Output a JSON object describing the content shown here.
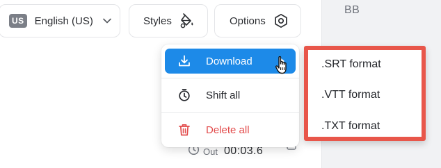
{
  "toolbar": {
    "language_code": "US",
    "language_label": "English (US)",
    "styles_label": "Styles",
    "options_label": "Options"
  },
  "right_panel": {
    "text": "BB"
  },
  "menu": {
    "items": [
      {
        "label": "Download",
        "icon": "download-icon",
        "state": "hover"
      },
      {
        "label": "Shift all",
        "icon": "timer-icon"
      },
      {
        "label": "Delete all",
        "icon": "trash-icon",
        "color": "#e24b4b"
      }
    ],
    "highlight_color": "#1d8ae8"
  },
  "submenu": {
    "items": [
      ".SRT format",
      ".VTT format",
      ".TXT format"
    ],
    "outline_color": "#e8564a"
  },
  "timing": {
    "out_label": "Out",
    "out_time": "00:03.6"
  }
}
